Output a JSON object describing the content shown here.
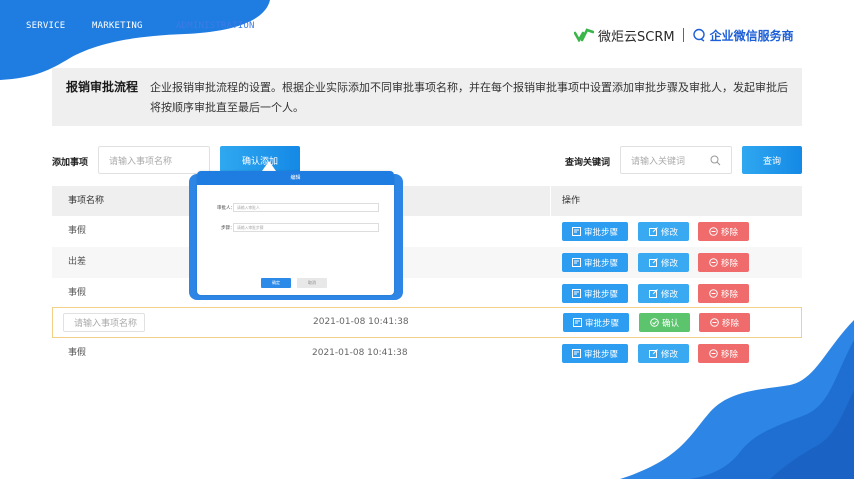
{
  "nav": {
    "items": [
      "SERVICE",
      "MARKETING",
      "ADMINISTRATION"
    ]
  },
  "brand": {
    "name": "微炬云SCRM",
    "tagline": "企业微信服务商"
  },
  "intro": {
    "title": "报销审批流程",
    "description": "企业报销审批流程的设置。根据企业实际添加不同审批事项名称，并在每个报销审批事项中设置添加审批步骤及审批人，发起审批后将按顺序审批直至最后一个人。"
  },
  "toolbar": {
    "add_label": "添加事项",
    "add_placeholder": "请输入事项名称",
    "add_button": "确认添加",
    "search_label": "查询关键词",
    "search_placeholder": "请输入关键词",
    "search_button": "查询"
  },
  "table": {
    "headers": {
      "name": "事项名称",
      "actions": "操作"
    },
    "rows": [
      {
        "name": "事假",
        "time": ""
      },
      {
        "name": "出差",
        "time": ""
      },
      {
        "name": "事假",
        "time": ""
      },
      {
        "name": "",
        "time": "2021-01-08 10:41:38"
      },
      {
        "name": "事假",
        "time": "2021-01-08 10:41:38"
      }
    ],
    "edit_placeholder": "请输入事项名称",
    "actions": {
      "step": "审批步骤",
      "edit": "修改",
      "confirm": "确认",
      "remove": "移除"
    }
  },
  "modal": {
    "title": "编辑",
    "field1_label": "审批人：",
    "field1_placeholder": "请输入审批人",
    "field2_label": "步骤：",
    "field2_placeholder": "请输入审批步骤",
    "confirm": "确定",
    "cancel": "取消"
  },
  "colors": {
    "primary": "#1f7ce0",
    "accent_blue": "#2c9df0",
    "success": "#5cc46d",
    "danger": "#f06c6c",
    "edit_border": "#f2d088"
  }
}
